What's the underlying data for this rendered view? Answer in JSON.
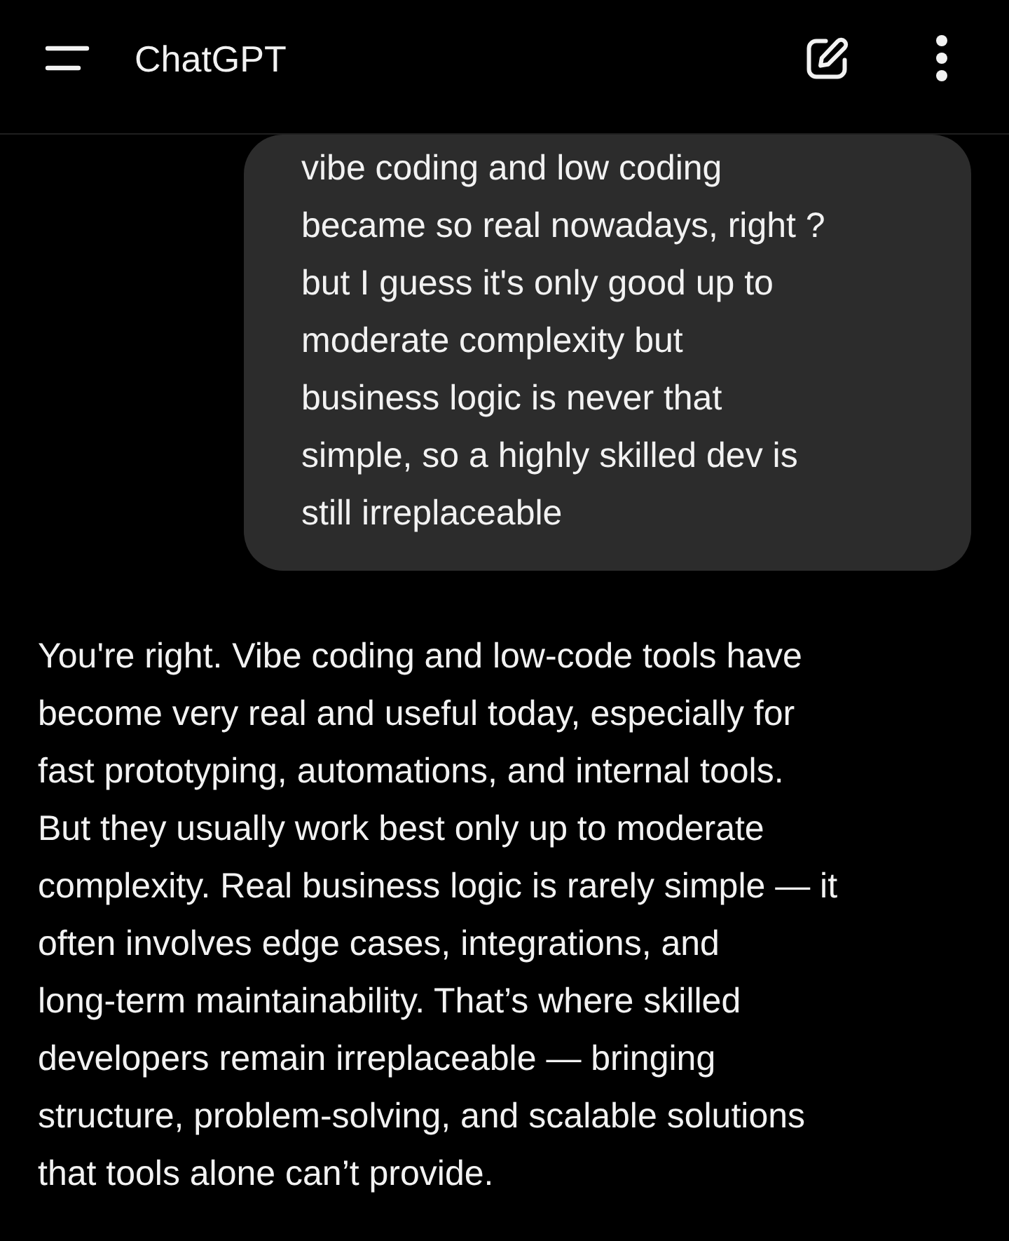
{
  "app_bar": {
    "title": "ChatGPT"
  },
  "messages": [
    {
      "kind": "user",
      "text": "vibe coding and low coding\nbecame so real nowadays, right ?\nbut I guess it's only good up to\nmoderate complexity but\nbusiness logic is never that\nsimple, so a highly skilled dev is\nstill irreplaceable"
    },
    {
      "kind": "assistant",
      "text": "You're right. Vibe coding and low-code tools have\nbecome very real and useful today, especially for\nfast prototyping, automations, and internal tools.\nBut they usually work best only up to moderate\ncomplexity. Real business logic is rarely simple — it\noften involves edge cases, integrations, and\nlong-term maintainability. That’s where skilled\ndevelopers remain irreplaceable — bringing\nstructure, problem-solving, and scalable solutions\nthat tools alone can’t provide."
    }
  ]
}
